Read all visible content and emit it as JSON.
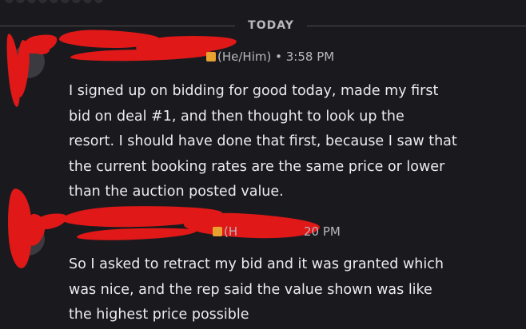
{
  "day_divider": "TODAY",
  "messages": [
    {
      "pronouns": "(He/Him)",
      "separator": "•",
      "time": "3:58 PM",
      "lines": [
        "I signed up on bidding for good today, made my first",
        "bid on deal #1, and then thought to look up the",
        "resort. I should have done that first, because I saw that",
        "the current booking rates are the same price or lower",
        "than the auction posted value."
      ]
    },
    {
      "pronouns_fragment": "(H",
      "time_fragment": "20 PM",
      "lines": [
        "So I asked to retract my bid and it was granted which",
        "was nice, and the rep said the value shown was like",
        "the highest price possible"
      ]
    }
  ],
  "colors": {
    "background": "#1a1a1e",
    "redaction": "#e01818",
    "role_badge": "#e8a22f"
  }
}
